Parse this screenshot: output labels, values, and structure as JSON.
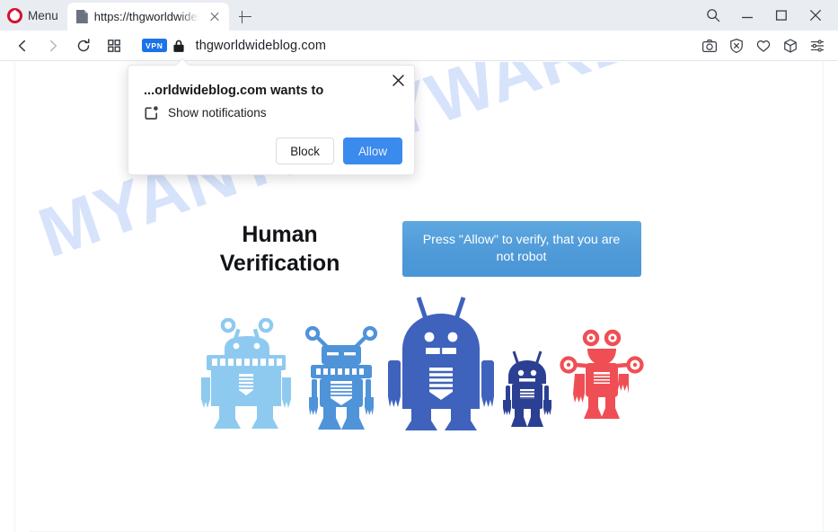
{
  "browser": {
    "name": "Opera",
    "menu_label": "Menu",
    "tab": {
      "title": "https://thgworldwidek",
      "favicon_name": "page-icon",
      "close_label": "×"
    },
    "new_tab_label": "+",
    "window_controls": [
      {
        "name": "search-icon",
        "label": "Search"
      },
      {
        "name": "minimize-icon",
        "label": "Minimize"
      },
      {
        "name": "maximize-icon",
        "label": "Maximize"
      },
      {
        "name": "close-icon",
        "label": "Close"
      }
    ],
    "address_bar": {
      "back_label": "Back",
      "forward_label": "Forward",
      "reload_label": "Reload",
      "tiles_label": "Speed Dial",
      "vpn_badge": "VPN",
      "lock_name": "lock-icon",
      "url": "thgworldwideblog.com"
    },
    "toolbar_right": [
      {
        "name": "snapshot-icon",
        "label": "Snapshot"
      },
      {
        "name": "ad-blocker-icon",
        "label": "Ad blocker"
      },
      {
        "name": "heart-icon",
        "label": "Add to favorites"
      },
      {
        "name": "cube-icon",
        "label": "Extensions"
      },
      {
        "name": "easy-setup-icon",
        "label": "Easy setup"
      }
    ]
  },
  "notification_dialog": {
    "origin_text": "...orldwideblog.com wants to",
    "permission_icon": "notifications-icon",
    "permission_text": "Show notifications",
    "block_label": "Block",
    "allow_label": "Allow",
    "close_label": "×",
    "allow_color": "#3b8aee"
  },
  "page": {
    "watermark": "MYANTISPYWARE.COM",
    "heading_line1": "Human",
    "heading_line2": "Verification",
    "banner_text": "Press \"Allow\" to verify, that you are not robot",
    "banner_color": "#4f9ad8",
    "robots": [
      {
        "name": "robot-1",
        "color": "#8ecaf0",
        "height": 118
      },
      {
        "name": "robot-2",
        "color": "#4f93d9",
        "height": 110
      },
      {
        "name": "robot-3",
        "color": "#3f62bd",
        "height": 142
      },
      {
        "name": "robot-4",
        "color": "#2b3f93",
        "height": 82
      },
      {
        "name": "robot-5",
        "color": "#ef4f54",
        "height": 106
      }
    ]
  }
}
